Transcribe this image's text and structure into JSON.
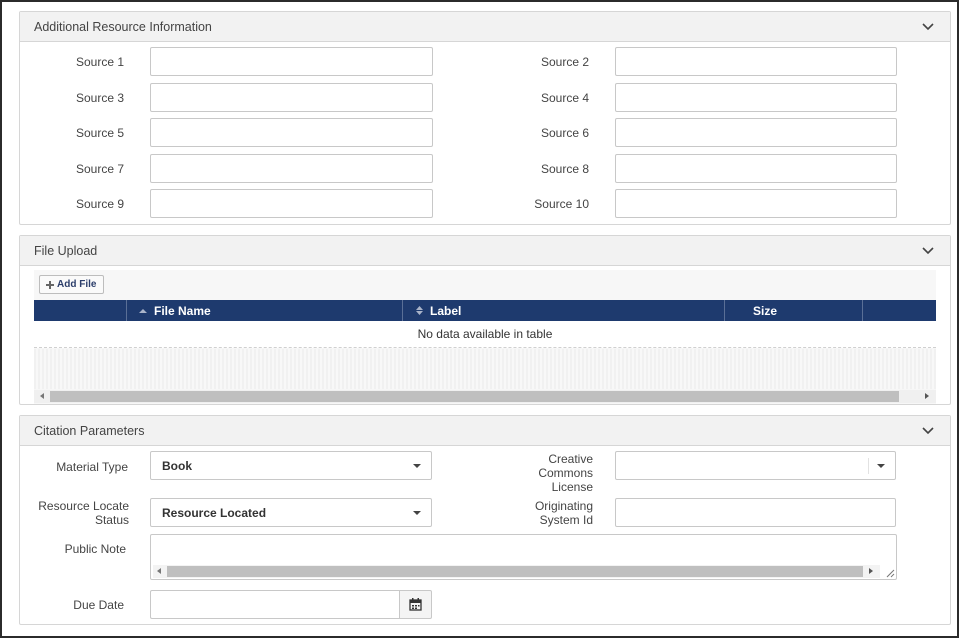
{
  "additional": {
    "title": "Additional Resource Information",
    "sources": [
      {
        "label": "Source 1",
        "value": ""
      },
      {
        "label": "Source 2",
        "value": ""
      },
      {
        "label": "Source 3",
        "value": ""
      },
      {
        "label": "Source 4",
        "value": ""
      },
      {
        "label": "Source 5",
        "value": ""
      },
      {
        "label": "Source 6",
        "value": ""
      },
      {
        "label": "Source 7",
        "value": ""
      },
      {
        "label": "Source 8",
        "value": ""
      },
      {
        "label": "Source 9",
        "value": ""
      },
      {
        "label": "Source 10",
        "value": ""
      }
    ]
  },
  "file_upload": {
    "title": "File Upload",
    "add_file_label": "Add File",
    "columns": [
      "File Name",
      "Label",
      "Size"
    ],
    "empty_text": "No data available in table"
  },
  "citation": {
    "title": "Citation Parameters",
    "material_type_label": "Material Type",
    "material_type_value": "Book",
    "cc_license_label_1": "Creative",
    "cc_license_label_2": "Commons",
    "cc_license_label_3": "License",
    "cc_license_value": "",
    "locate_status_label_1": "Resource Locate",
    "locate_status_label_2": "Status",
    "locate_status_value": "Resource Located",
    "orig_system_label_1": "Originating",
    "orig_system_label_2": "System Id",
    "orig_system_value": "",
    "public_note_label": "Public Note",
    "public_note_value": "",
    "due_date_label": "Due Date",
    "due_date_value": ""
  },
  "colors": {
    "table_header": "#1e3a6e",
    "panel_header": "#f2f2f2",
    "border": "#d6d6d6"
  }
}
